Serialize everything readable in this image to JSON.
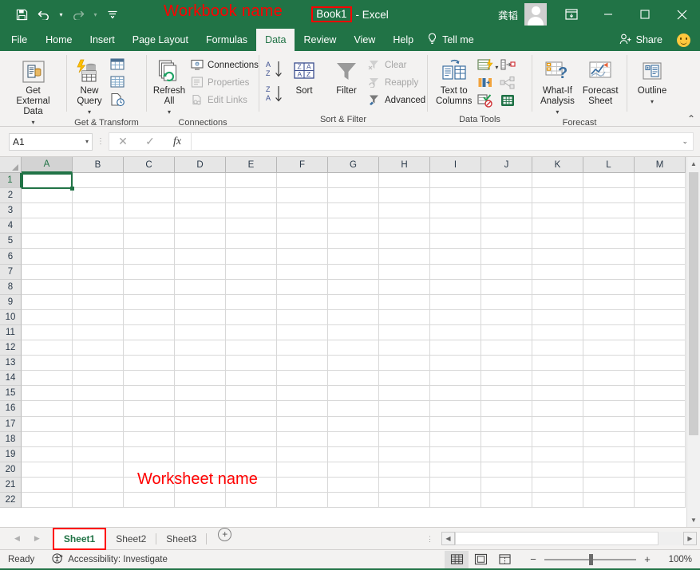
{
  "window": {
    "title_book": "Book1",
    "title_rest": "- Excel",
    "user_name": "龚韬",
    "annotation_workbook": "Workbook name",
    "annotation_worksheet": "Worksheet name",
    "annotation_color": "#ff0000",
    "accent_color": "#217346"
  },
  "quick_access": [
    {
      "name": "save",
      "glyph": "save-icon"
    },
    {
      "name": "undo",
      "glyph": "undo-icon"
    },
    {
      "name": "redo",
      "glyph": "redo-icon"
    },
    {
      "name": "customize",
      "glyph": "customize-qat-icon"
    }
  ],
  "window_buttons": {
    "ribbon_display": "ribbon-display-options",
    "minimize": "—",
    "maximize": "☐",
    "close": "✕"
  },
  "tabs": [
    {
      "label": "File",
      "active": false
    },
    {
      "label": "Home",
      "active": false
    },
    {
      "label": "Insert",
      "active": false
    },
    {
      "label": "Page Layout",
      "active": false
    },
    {
      "label": "Formulas",
      "active": false
    },
    {
      "label": "Data",
      "active": true
    },
    {
      "label": "Review",
      "active": false
    },
    {
      "label": "View",
      "active": false
    },
    {
      "label": "Help",
      "active": false
    }
  ],
  "tell_me": "Tell me",
  "share": "Share",
  "ribbon": {
    "groups": [
      {
        "name": "get-external-data",
        "label": "Get & Transform",
        "label_own": "",
        "big_buttons": [
          {
            "label": "Get External\nData",
            "has_caret": true,
            "icon": "get-external-data-icon"
          }
        ]
      },
      {
        "name": "get-and-transform",
        "label": "Get & Transform",
        "big_buttons": [
          {
            "label": "New\nQuery",
            "has_caret": true,
            "icon": "new-query-icon"
          }
        ],
        "icon_buttons": [
          {
            "name": "show-queries-icon"
          },
          {
            "name": "from-table-icon"
          },
          {
            "name": "recent-sources-icon"
          }
        ]
      },
      {
        "name": "connections",
        "label": "Connections",
        "big_buttons": [
          {
            "label": "Refresh\nAll",
            "has_caret": true,
            "icon": "refresh-all-icon"
          }
        ],
        "small_buttons": [
          {
            "label": "Connections",
            "disabled": false,
            "icon": "connections-icon"
          },
          {
            "label": "Properties",
            "disabled": true,
            "icon": "properties-icon"
          },
          {
            "label": "Edit Links",
            "disabled": true,
            "icon": "edit-links-icon"
          }
        ]
      },
      {
        "name": "sort-and-filter",
        "label": "Sort & Filter",
        "big_buttons": [
          {
            "label": "Sort",
            "has_caret": false,
            "icon": "sort-dialog-icon"
          },
          {
            "label": "Filter",
            "has_caret": false,
            "icon": "filter-icon"
          }
        ],
        "icon_buttons": [
          {
            "name": "sort-ascending-icon"
          },
          {
            "name": "sort-descending-icon"
          }
        ],
        "small_buttons": [
          {
            "label": "Clear",
            "disabled": true,
            "icon": "clear-filter-icon"
          },
          {
            "label": "Reapply",
            "disabled": true,
            "icon": "reapply-icon"
          },
          {
            "label": "Advanced",
            "disabled": false,
            "icon": "advanced-filter-icon"
          }
        ]
      },
      {
        "name": "data-tools",
        "label": "Data Tools",
        "big_buttons": [
          {
            "label": "Text to\nColumns",
            "has_caret": false,
            "icon": "text-to-columns-icon"
          }
        ],
        "icon_buttons": [
          {
            "name": "flash-fill-icon"
          },
          {
            "name": "remove-duplicates-icon"
          },
          {
            "name": "data-validation-icon"
          },
          {
            "name": "consolidate-icon"
          },
          {
            "name": "relationships-icon"
          },
          {
            "name": "manage-data-model-icon"
          }
        ]
      },
      {
        "name": "forecast",
        "label": "Forecast",
        "big_buttons": [
          {
            "label": "What-If\nAnalysis",
            "has_caret": true,
            "icon": "what-if-analysis-icon"
          },
          {
            "label": "Forecast\nSheet",
            "has_caret": false,
            "icon": "forecast-sheet-icon"
          }
        ]
      },
      {
        "name": "outline",
        "label": "",
        "big_buttons": [
          {
            "label": "Outline",
            "has_caret": true,
            "icon": "outline-icon"
          }
        ]
      }
    ]
  },
  "formula_bar": {
    "name_box_value": "A1",
    "cancel": "✕",
    "enter": "✓",
    "function": "fx",
    "formula_value": "",
    "formula_placeholder": ""
  },
  "grid": {
    "columns": [
      "A",
      "B",
      "C",
      "D",
      "E",
      "F",
      "G",
      "H",
      "I",
      "J",
      "K",
      "L",
      "M"
    ],
    "rows": [
      "1",
      "2",
      "3",
      "4",
      "5",
      "6",
      "7",
      "8",
      "9",
      "10",
      "11",
      "12",
      "13",
      "14",
      "15",
      "16",
      "17",
      "18",
      "19",
      "20",
      "21",
      "22"
    ],
    "active_cell": "A1",
    "active_column": "A",
    "active_row": "1"
  },
  "sheet_tabs": {
    "items": [
      {
        "label": "Sheet1",
        "active": true
      },
      {
        "label": "Sheet2",
        "active": false
      },
      {
        "label": "Sheet3",
        "active": false
      }
    ],
    "add_label": "+",
    "nav_prev": "◀",
    "nav_next": "▶"
  },
  "status_bar": {
    "mode": "Ready",
    "accessibility": "Accessibility: Investigate",
    "views": [
      {
        "name": "normal-view",
        "active": true
      },
      {
        "name": "page-layout-view",
        "active": false
      },
      {
        "name": "page-break-preview",
        "active": false
      }
    ],
    "zoom_out": "−",
    "zoom_in": "+",
    "zoom_value": "100%"
  }
}
